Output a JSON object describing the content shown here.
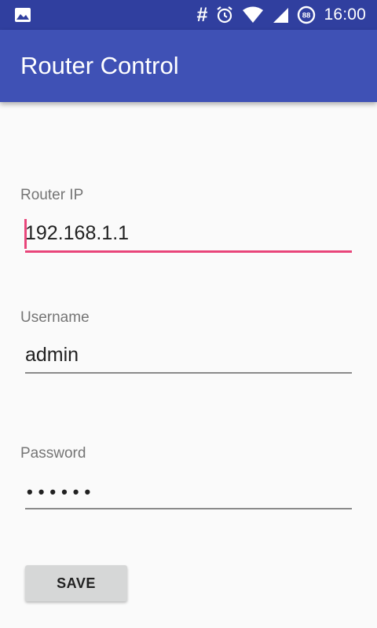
{
  "status_bar": {
    "time": "16:00",
    "hash_symbol": "#",
    "battery_level": "88",
    "icons": [
      "image-icon",
      "hash-icon",
      "alarm-icon",
      "wifi-icon",
      "signal-icon",
      "battery-icon"
    ]
  },
  "app_bar": {
    "title": "Router Control",
    "color": "#3f51b5",
    "status_color": "#303f9f"
  },
  "form": {
    "router_ip": {
      "label": "Router IP",
      "value": "192.168.1.1"
    },
    "username": {
      "label": "Username",
      "value": "admin"
    },
    "password": {
      "label": "Password",
      "masked_value": "••••••"
    },
    "accent_color": "#e8457a"
  },
  "save_button": {
    "label": "SAVE"
  }
}
